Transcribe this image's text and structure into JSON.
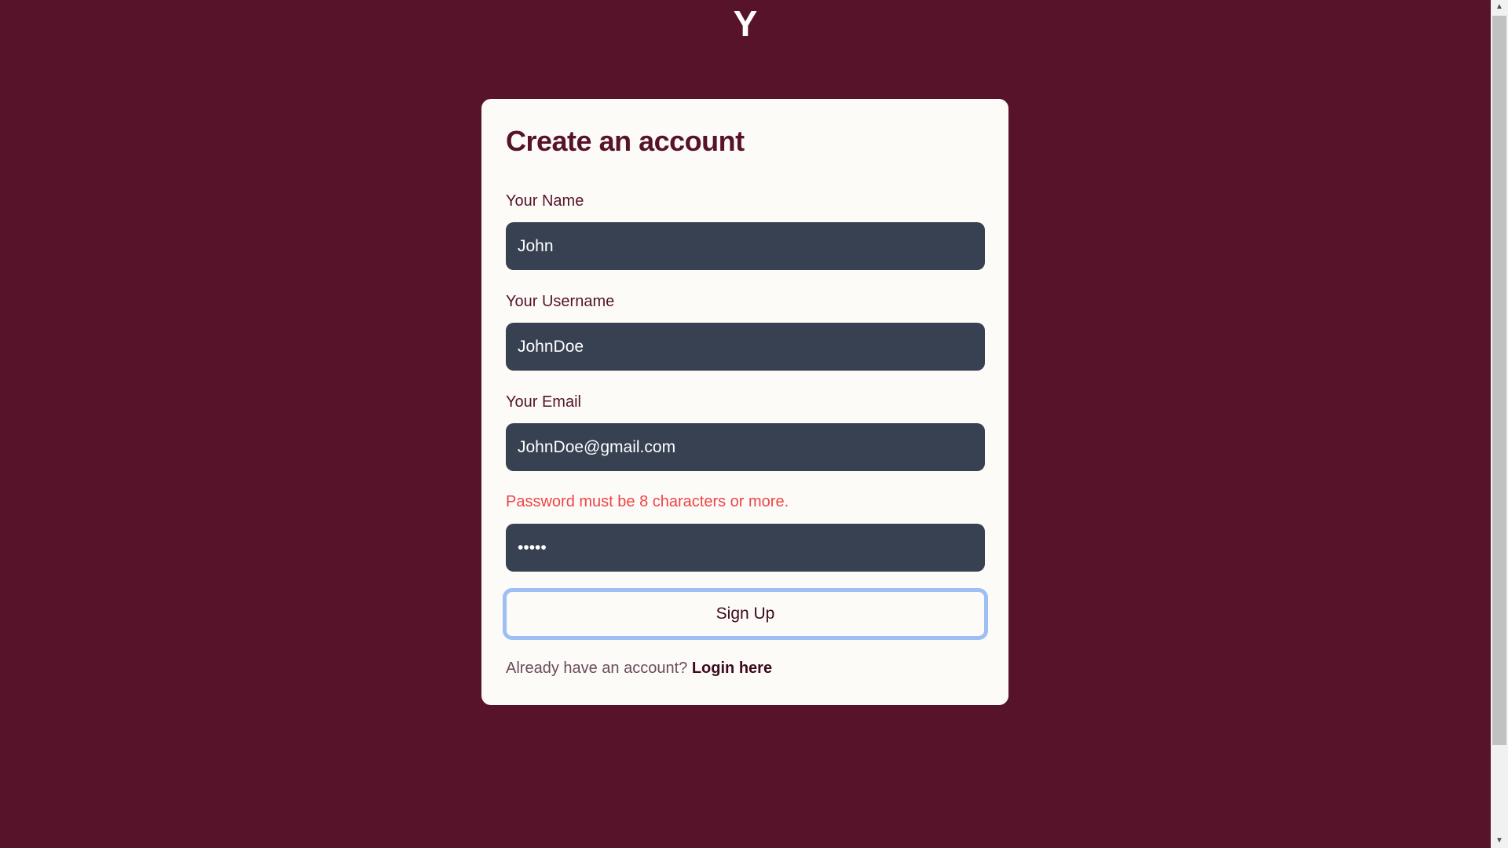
{
  "logo": "Y",
  "form": {
    "title": "Create an account",
    "fields": [
      {
        "label": "Your Name",
        "value": "John"
      },
      {
        "label": "Your Username",
        "value": "JohnDoe"
      },
      {
        "label": "Your Email",
        "value": "JohnDoe@gmail.com"
      }
    ],
    "password": {
      "error": "Password must be 8 characters or more.",
      "value": "12345"
    },
    "submit_label": "Sign Up",
    "footer_text": "Already have an account?",
    "login_link": "Login here"
  },
  "colors": {
    "background": "#561329",
    "card": "#fcfbf8",
    "input": "#374151",
    "error": "#ef4444",
    "focus_ring": "#9dbff3"
  }
}
